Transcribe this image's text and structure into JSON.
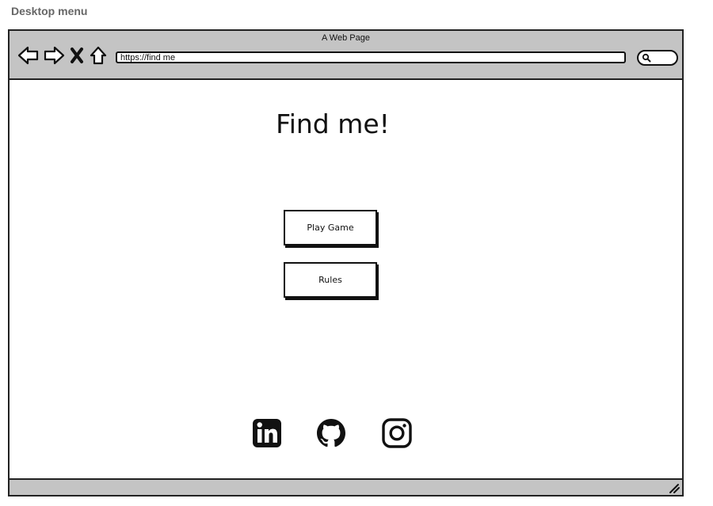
{
  "caption": "Desktop menu",
  "window": {
    "title": "A Web Page",
    "url": "https://find me"
  },
  "toolbar": {
    "icons": [
      "back-arrow-icon",
      "forward-arrow-icon",
      "close-x-icon",
      "home-icon",
      "search-icon"
    ]
  },
  "page": {
    "heading": "Find me!",
    "buttons": {
      "play": "Play Game",
      "rules": "Rules"
    },
    "social_icons": [
      "linkedin-icon",
      "github-icon",
      "instagram-icon"
    ]
  },
  "colors": {
    "chrome": "#c4c4c4",
    "stroke": "#111111",
    "caption": "#666666"
  }
}
